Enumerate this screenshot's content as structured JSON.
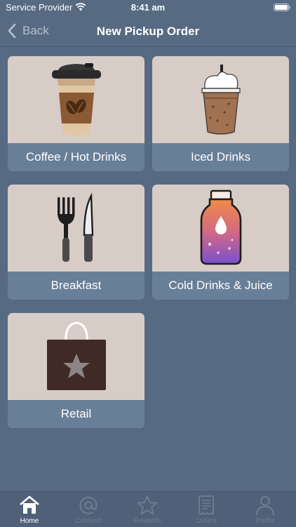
{
  "status_bar": {
    "carrier": "Service Provider",
    "time": "8:41 am",
    "wifi_icon": "wifi-icon",
    "battery_icon": "battery-icon"
  },
  "nav": {
    "back_label": "Back",
    "title": "New Pickup Order",
    "back_icon": "chevron-left-icon"
  },
  "categories": [
    {
      "label": "Coffee / Hot Drinks",
      "icon": "coffee-cup-icon"
    },
    {
      "label": "Iced Drinks",
      "icon": "iced-drink-icon"
    },
    {
      "label": "Breakfast",
      "icon": "fork-knife-icon"
    },
    {
      "label": "Cold Drinks & Juice",
      "icon": "juice-bottle-icon"
    },
    {
      "label": "Retail",
      "icon": "shopping-bag-icon"
    }
  ],
  "tabs": [
    {
      "label": "Home",
      "icon": "home-icon",
      "active": true
    },
    {
      "label": "Connect",
      "icon": "at-sign-icon",
      "active": false
    },
    {
      "label": "Rewards",
      "icon": "star-icon",
      "active": false
    },
    {
      "label": "Orders",
      "icon": "receipt-icon",
      "active": false
    },
    {
      "label": "Profile",
      "icon": "person-icon",
      "active": false
    }
  ],
  "colors": {
    "background": "#566a82",
    "tile_image_bg": "#d8ccc7",
    "tile_label_bg": "#687f98",
    "tab_bar": "#4f6078",
    "tab_active": "#ffffff",
    "tab_inactive": "#6d7f93"
  }
}
